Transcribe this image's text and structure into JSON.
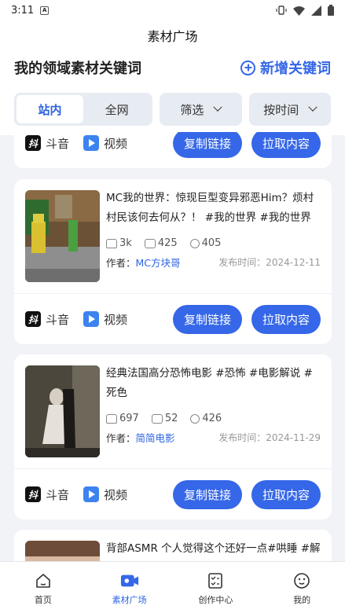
{
  "status": {
    "time": "3:11",
    "notif": "A"
  },
  "header": {
    "title": "素材广场"
  },
  "section": {
    "title": "我的领域素材关键词",
    "add_label": "新增关键词"
  },
  "filters": {
    "segments": [
      "站内",
      "全网"
    ],
    "dropdown1": "筛选",
    "dropdown2": "按时间"
  },
  "labels": {
    "author_prefix": "作者：",
    "time_prefix": "发布时间：",
    "platform": "斗音",
    "type": "视频",
    "copy": "复制链接",
    "pull": "拉取内容"
  },
  "cards": [
    {
      "title": "MC我的世界：惊现巨型变异邪恶Him？烦村村民该何去何从？！ #我的世界 #我的世界mi",
      "likes": "3k",
      "comments": "425",
      "shares": "405",
      "author": "MC方块哥",
      "time": "2024-12-11"
    },
    {
      "title": "经典法国高分恐怖电影 #恐怖 #电影解说 #死色",
      "likes": "697",
      "comments": "52",
      "shares": "426",
      "author": "简简电影",
      "time": "2024-11-29"
    },
    {
      "title": "背部ASMR 个人觉得这个还好一点#哄睡 #解"
    }
  ],
  "tabs": [
    "首页",
    "素材广场",
    "创作中心",
    "我的"
  ],
  "colors": {
    "accent": "#3567e8",
    "bg": "#f1f3f6"
  }
}
